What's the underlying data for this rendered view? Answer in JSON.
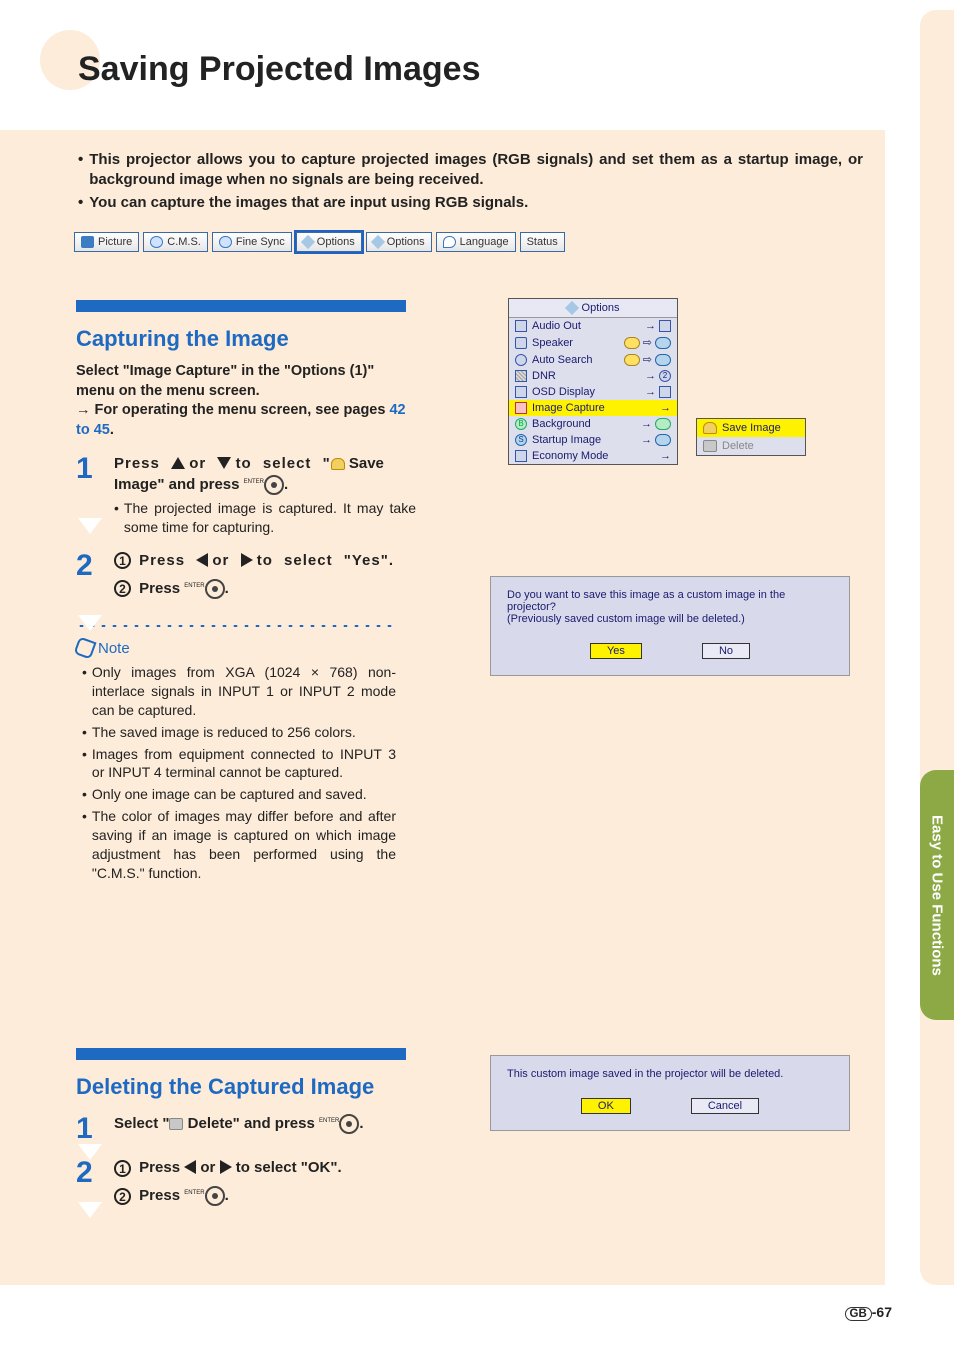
{
  "page": {
    "title": "Saving Projected Images",
    "intro_bullets": [
      "This projector allows you to capture projected images (RGB signals) and set them as a startup image, or background image when no signals are being received.",
      "You can capture the images that are input using RGB signals."
    ],
    "sidebar_label": "Easy to Use Functions",
    "page_number": "-67",
    "page_region": "GB"
  },
  "tabs": {
    "items": [
      {
        "label": "Picture"
      },
      {
        "label": "C.M.S."
      },
      {
        "label": "Fine Sync"
      },
      {
        "label": "Options"
      },
      {
        "label": "Options"
      },
      {
        "label": "Language"
      },
      {
        "label": "Status"
      }
    ],
    "selected_index": 3
  },
  "section_capture": {
    "heading": "Capturing the Image",
    "lead_part1": "Select \"Image Capture\" in the \"Options (1)\" menu on the menu screen.",
    "lead_part2": "For operating the menu screen, see pages ",
    "lead_link": "42 to 45",
    "lead_period": ".",
    "step1": {
      "line_pre": "Press ",
      "line_mid": " or ",
      "line_post1": " to select \"",
      "line_post2": " Save Image\" and press ",
      "sub": "The projected image is captured. It may take some time for capturing."
    },
    "step2": {
      "sub1_pre": "Press ",
      "sub1_mid": " or ",
      "sub1_post": " to select \"Yes\".",
      "sub2": "Press "
    },
    "enter_label": "ENTER"
  },
  "note": {
    "label": "Note",
    "items": [
      "Only images from XGA (1024 × 768) non-interlace signals in INPUT 1 or INPUT 2 mode can be captured.",
      "The saved image is reduced to 256 colors.",
      "Images from equipment connected to INPUT 3 or INPUT 4 terminal cannot be captured.",
      "Only one image can be captured and saved.",
      "The color of images may differ before and after saving if an image is captured on which image adjustment has been performed using the \"C.M.S.\" function."
    ]
  },
  "section_delete": {
    "heading": "Deleting the Captured Image",
    "step1_pre": "Select \"",
    "step1_mid": " Delete\" and press ",
    "step2_sub1_pre": "Press ",
    "step2_sub1_mid": " or ",
    "step2_sub1_post": " to select \"OK\".",
    "step2_sub2": "Press "
  },
  "osd": {
    "title": "Options",
    "items": [
      {
        "label": "Audio Out"
      },
      {
        "label": "Speaker"
      },
      {
        "label": "Auto Search"
      },
      {
        "label": "DNR"
      },
      {
        "label": "OSD Display"
      },
      {
        "label": "Image Capture"
      },
      {
        "label": "Background"
      },
      {
        "label": "Startup Image"
      },
      {
        "label": "Economy Mode"
      }
    ],
    "selected_index": 5,
    "submenu": {
      "items": [
        {
          "label": "Save Image"
        },
        {
          "label": "Delete"
        }
      ],
      "selected_index": 0
    }
  },
  "dialog_save": {
    "line1": "Do you want to save this image as a custom image in the projector?",
    "line2": "(Previously saved custom image will be deleted.)",
    "yes": "Yes",
    "no": "No"
  },
  "dialog_delete": {
    "line1": "This custom image saved in the projector will be deleted.",
    "ok": "OK",
    "cancel": "Cancel"
  }
}
